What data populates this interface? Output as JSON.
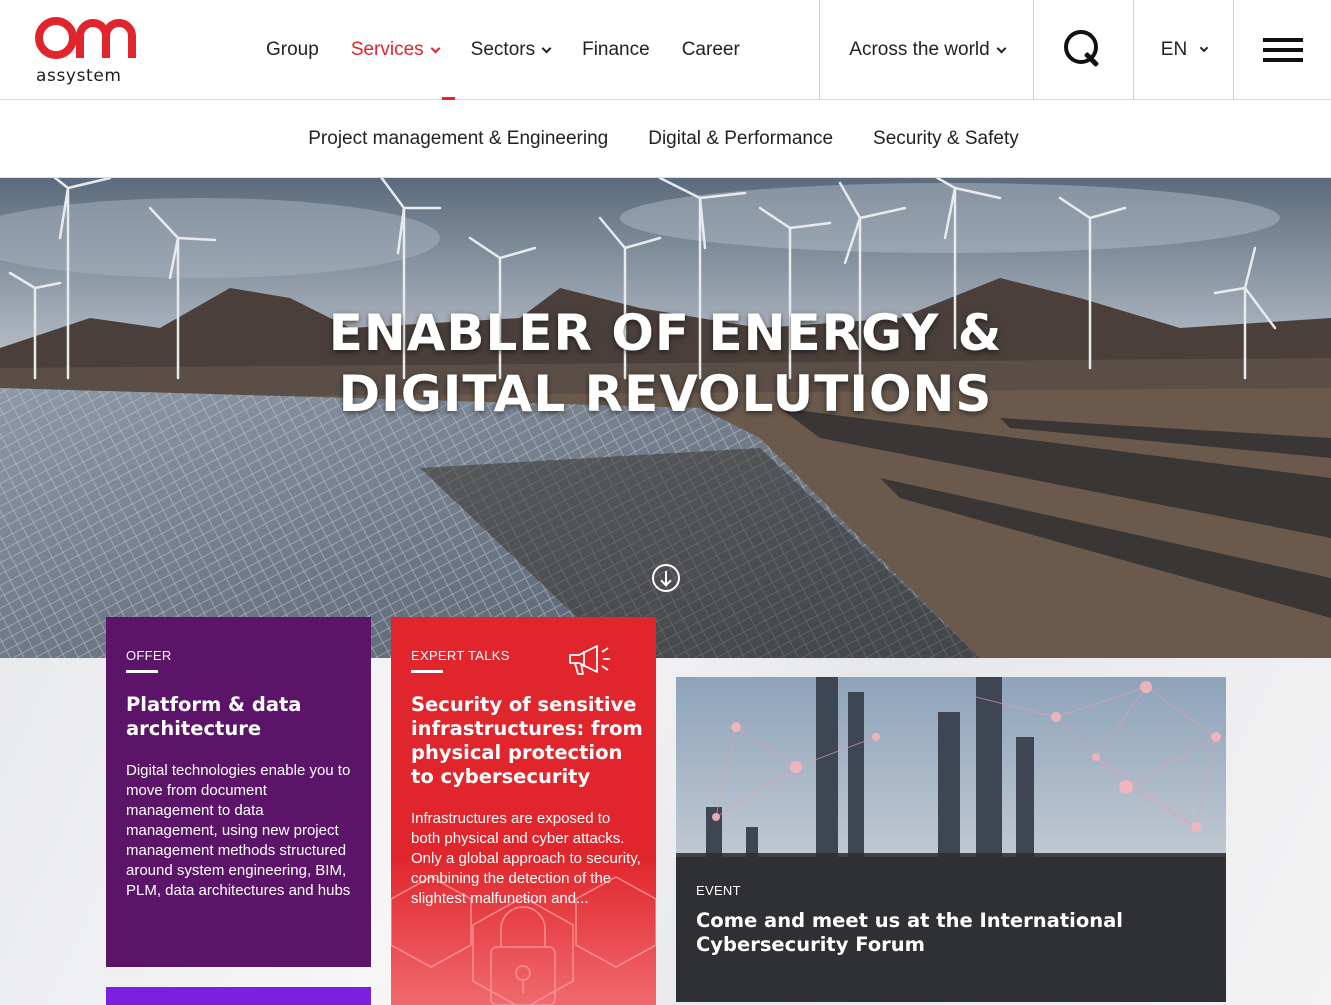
{
  "brand": {
    "wordmark": "assystem",
    "accent": "#e0262c"
  },
  "nav": {
    "items": [
      {
        "label": "Group",
        "dropdown": false
      },
      {
        "label": "Services",
        "dropdown": true,
        "active": true
      },
      {
        "label": "Sectors",
        "dropdown": true
      },
      {
        "label": "Finance",
        "dropdown": false
      },
      {
        "label": "Career",
        "dropdown": false
      }
    ],
    "world": "Across the world",
    "search_icon": "search-icon",
    "language": "EN",
    "menu_icon": "hamburger-icon"
  },
  "subnav": {
    "items": [
      "Project management & Engineering",
      "Digital & Performance",
      "Security & Safety"
    ]
  },
  "hero": {
    "title_line1": "ENABLER OF ENERGY &",
    "title_line2": "DIGITAL REVOLUTIONS",
    "scroll_icon": "arrow-down-circle-icon"
  },
  "cards": {
    "offer": {
      "kicker": "OFFER",
      "title": "Platform & data architecture",
      "text": "Digital technologies enable you to move from document management to data management, using new project management methods structured around system engineering, BIM, PLM, data architectures and hubs",
      "color": "#5c1468"
    },
    "talks": {
      "kicker": "EXPERT TALKS",
      "title": "Security of sensitive infrastructures: from physical protection to cybersecurity",
      "text": "Infrastructures are exposed to both physical and cyber attacks. Only a global approach to security, combining the detection of the slightest malfunction and...",
      "color": "#e0262c",
      "icon": "megaphone-icon"
    },
    "event": {
      "kicker": "EVENT",
      "title": "Come and meet us at the International Cybersecurity Forum"
    }
  }
}
